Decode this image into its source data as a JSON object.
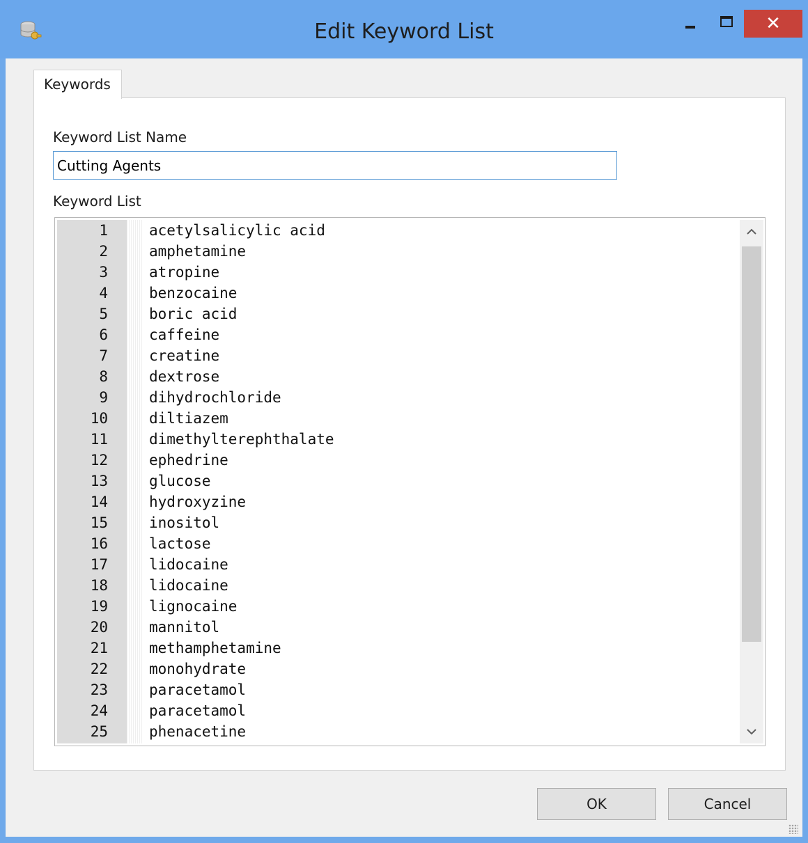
{
  "window": {
    "title": "Edit Keyword List",
    "icon": "database-key-icon",
    "close_glyph": "✕"
  },
  "tabs": [
    {
      "label": "Keywords",
      "active": true
    }
  ],
  "form": {
    "name_label": "Keyword List Name",
    "name_value": "Cutting Agents",
    "list_label": "Keyword List"
  },
  "keywords": [
    {
      "num": "1",
      "text": "acetylsalicylic acid"
    },
    {
      "num": "2",
      "text": "amphetamine"
    },
    {
      "num": "3",
      "text": "atropine"
    },
    {
      "num": "4",
      "text": "benzocaine"
    },
    {
      "num": "5",
      "text": "boric acid"
    },
    {
      "num": "6",
      "text": "caffeine"
    },
    {
      "num": "7",
      "text": "creatine"
    },
    {
      "num": "8",
      "text": "dextrose"
    },
    {
      "num": "9",
      "text": "dihydrochloride"
    },
    {
      "num": "10",
      "text": "diltiazem"
    },
    {
      "num": "11",
      "text": "dimethylterephthalate"
    },
    {
      "num": "12",
      "text": "ephedrine"
    },
    {
      "num": "13",
      "text": "glucose"
    },
    {
      "num": "14",
      "text": "hydroxyzine"
    },
    {
      "num": "15",
      "text": "inositol"
    },
    {
      "num": "16",
      "text": "lactose"
    },
    {
      "num": "17",
      "text": "lidocaine"
    },
    {
      "num": "18",
      "text": "lidocaine"
    },
    {
      "num": "19",
      "text": "lignocaine"
    },
    {
      "num": "20",
      "text": "mannitol"
    },
    {
      "num": "21",
      "text": "methamphetamine"
    },
    {
      "num": "22",
      "text": "monohydrate"
    },
    {
      "num": "23",
      "text": "paracetamol"
    },
    {
      "num": "24",
      "text": "paracetamol"
    },
    {
      "num": "25",
      "text": "phenacetine"
    }
  ],
  "buttons": {
    "ok": "OK",
    "cancel": "Cancel"
  },
  "colors": {
    "title_bar": "#6aa7ec",
    "close_button": "#c7423a",
    "input_focus_border": "#5b9bd5",
    "gutter": "#dcdcdc"
  }
}
